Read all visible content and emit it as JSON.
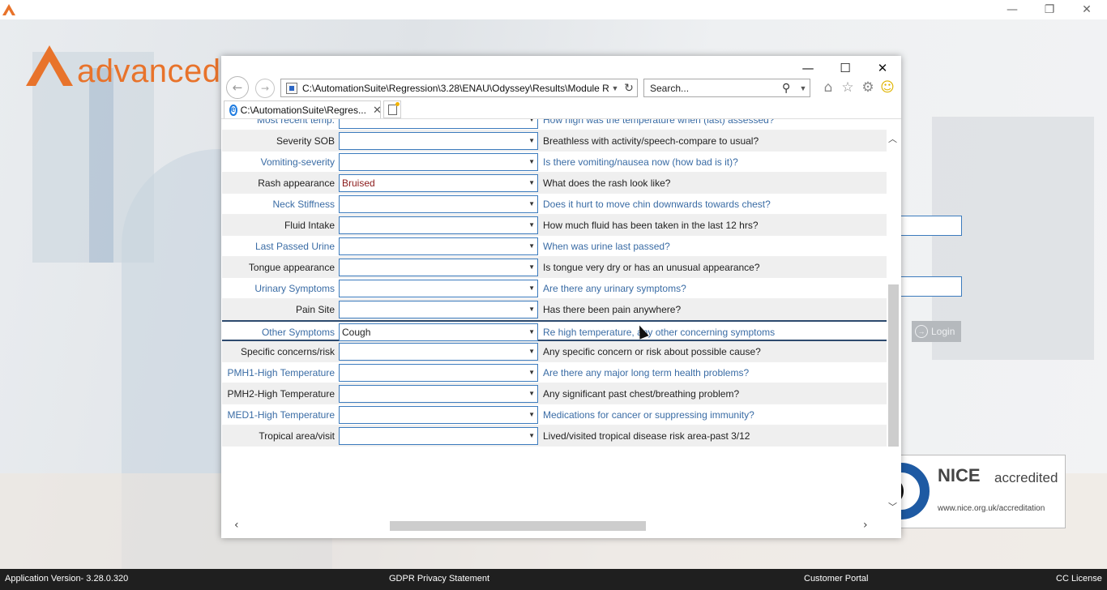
{
  "app": {
    "brand_text": "advanced",
    "window_controls": {
      "minimize": "—",
      "restore": "❐",
      "close": "✕"
    },
    "login_label": "Login",
    "nice": {
      "title": "NICE",
      "subtitle": "accredited",
      "url": "www.nice.org.uk/accreditation"
    },
    "statusbar": {
      "version": "Application Version- 3.28.0.320",
      "gdpr": "GDPR Privacy Statement",
      "portal": "Customer Portal",
      "license": "CC License"
    },
    "colors": {
      "brand_orange": "#e8732b",
      "status_bar": "#1f1f1f",
      "link_blue": "#3a6ca5",
      "nice_blue": "#1e5aa3"
    }
  },
  "browser": {
    "address": "C:\\AutomationSuite\\Regression\\3.28\\ENAU\\Odyssey\\Results\\Module R",
    "search_placeholder": "Search...",
    "tab_title": "C:\\AutomationSuite\\Regres...",
    "icons": [
      "back-icon",
      "forward-icon",
      "page-icon",
      "refresh-icon",
      "search-icon",
      "home-icon",
      "star-icon",
      "gear-icon",
      "smiley-icon"
    ],
    "rows": [
      {
        "label": "Most recent temp.",
        "value": "",
        "question": "How high was the temperature when (last) assessed?",
        "style": "blue"
      },
      {
        "label": "Severity SOB",
        "value": "",
        "question": "Breathless with activity/speech-compare to usual?",
        "style": "dark"
      },
      {
        "label": "Vomiting-severity",
        "value": "",
        "question": "Is there vomiting/nausea now (how bad is it)?",
        "style": "blue"
      },
      {
        "label": "Rash appearance",
        "value": "Bruised",
        "question": "What does the rash look like?",
        "style": "dark"
      },
      {
        "label": "Neck Stiffness",
        "value": "",
        "question": "Does it hurt to move chin downwards towards chest?",
        "style": "blue"
      },
      {
        "label": "Fluid Intake",
        "value": "",
        "question": "How much fluid has been taken in the last 12 hrs?",
        "style": "dark"
      },
      {
        "label": "Last Passed Urine",
        "value": "",
        "question": "When was urine last passed?",
        "style": "blue"
      },
      {
        "label": "Tongue appearance",
        "value": "",
        "question": "Is tongue very dry or has an unusual appearance?",
        "style": "dark"
      },
      {
        "label": "Urinary Symptoms",
        "value": "",
        "question": "Are there any urinary symptoms?",
        "style": "blue"
      },
      {
        "label": "Pain Site",
        "value": "",
        "question": "Has there been pain anywhere?",
        "style": "dark"
      },
      {
        "label": "Other Symptoms",
        "value": "Cough",
        "question": "Re high temperature, any other concerning symptoms",
        "style": "blue"
      },
      {
        "label": "Specific concerns/risk",
        "value": "",
        "question": "Any specific concern or risk about possible cause?",
        "style": "dark"
      },
      {
        "label": "PMH1-High Temperature",
        "value": "",
        "question": "Are there any major long term health problems?",
        "style": "blue"
      },
      {
        "label": "PMH2-High Temperature",
        "value": "",
        "question": "Any significant past chest/breathing problem?",
        "style": "dark"
      },
      {
        "label": "MED1-High Temperature",
        "value": "",
        "question": "Medications for cancer or suppressing immunity?",
        "style": "blue"
      },
      {
        "label": "Tropical area/visit",
        "value": "",
        "question": "Lived/visited tropical disease risk area-past 3/12",
        "style": "dark"
      }
    ]
  }
}
